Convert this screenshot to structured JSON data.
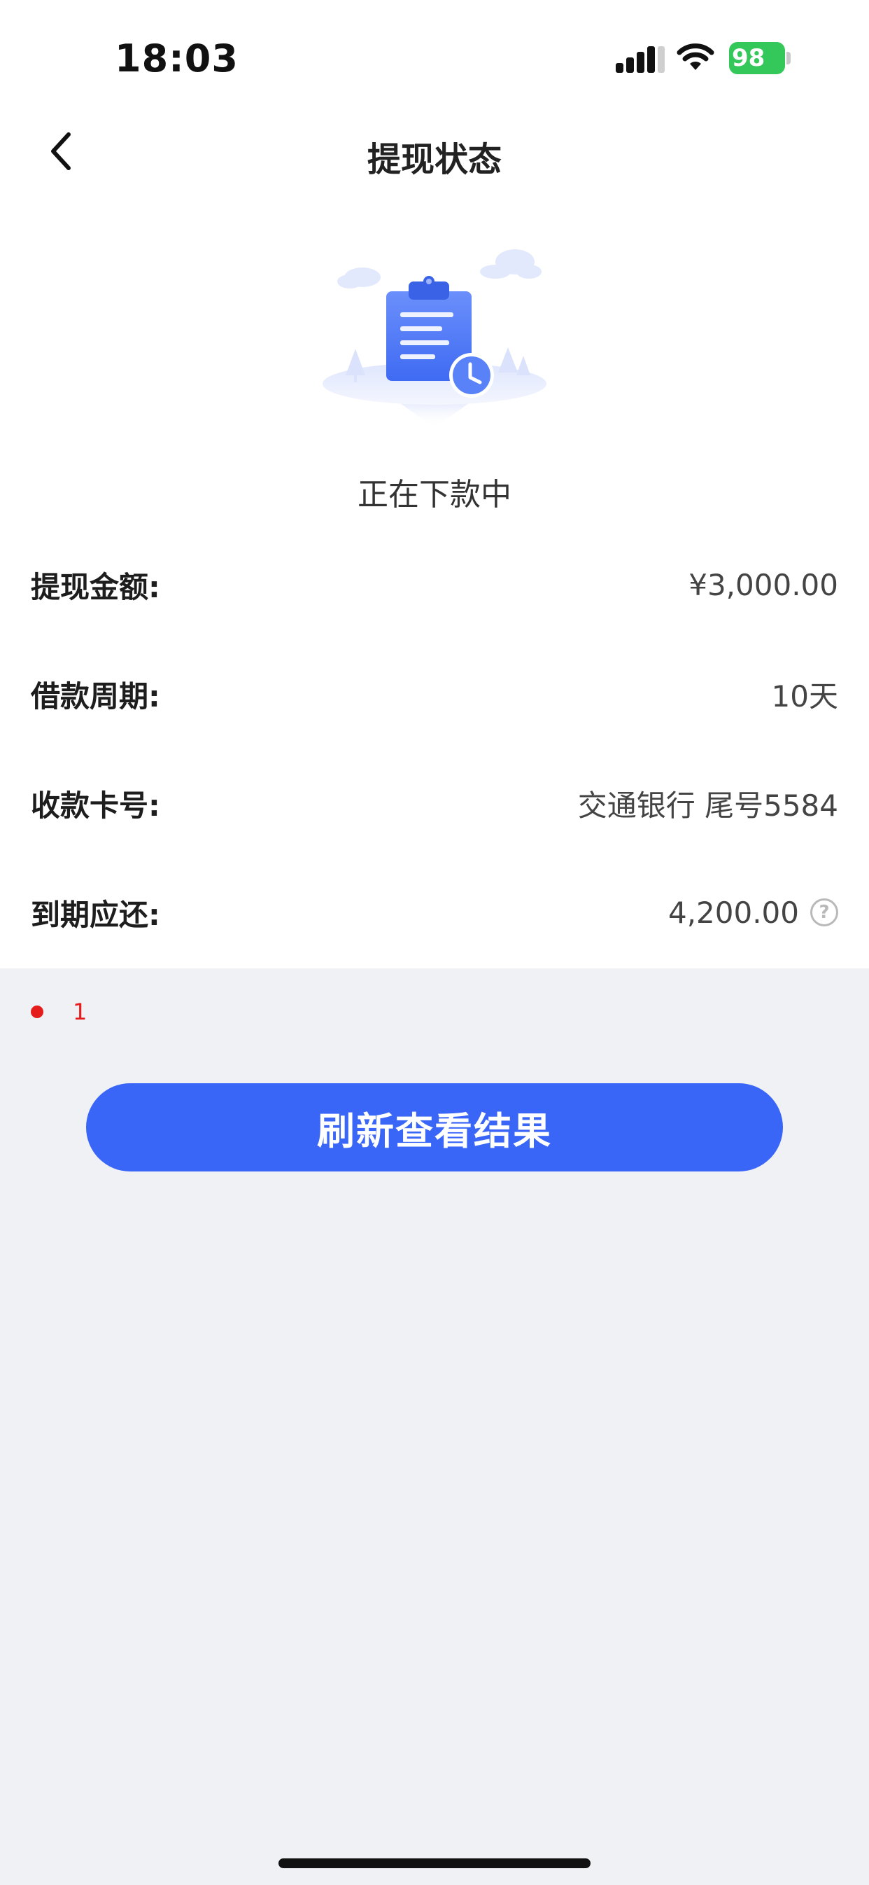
{
  "status_bar": {
    "time": "18:03",
    "battery": "98"
  },
  "nav": {
    "title": "提现状态",
    "back_icon": "chevron-left-icon"
  },
  "status": {
    "text": "正在下款中",
    "illustration": "clipboard-clock-illustration"
  },
  "details": [
    {
      "label": "提现金额:",
      "value": "¥3,000.00"
    },
    {
      "label": "借款周期:",
      "value": "10天"
    },
    {
      "label": "收款卡号:",
      "value": "交通银行 尾号5584"
    },
    {
      "label": "到期应还:",
      "value": "4,200.00",
      "help": "?"
    }
  ],
  "marker": {
    "text": "1",
    "color": "#e51c1c"
  },
  "actions": {
    "refresh_label": "刷新查看结果",
    "accent": "#3a66f8"
  }
}
